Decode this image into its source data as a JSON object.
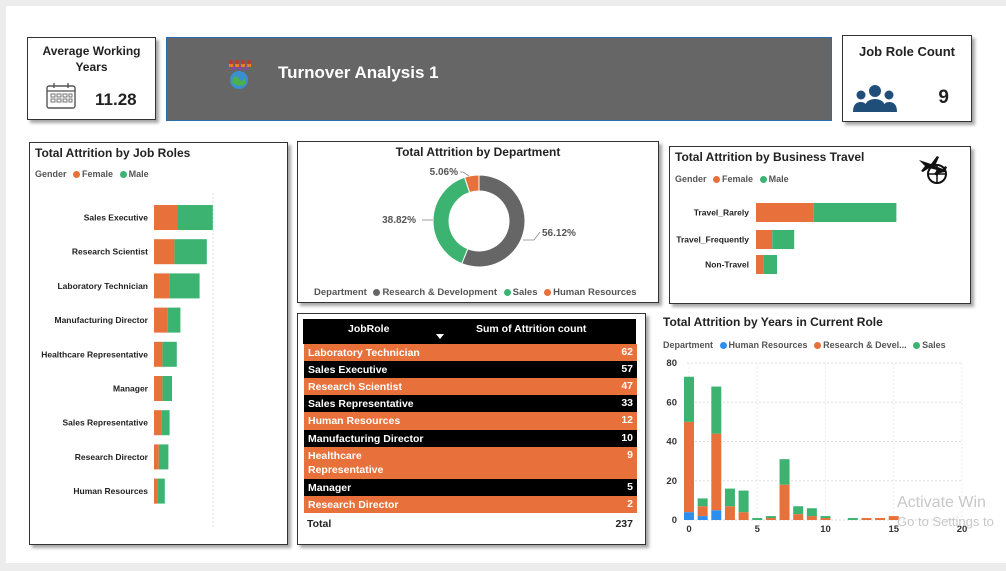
{
  "kpi_avg": {
    "label_line1": "Average Working",
    "label_line2": "Years",
    "value": "11.28",
    "icon": "calendar-icon"
  },
  "header": {
    "title": "Turnover Analysis 1",
    "icon": "people-globe-icon",
    "bg": "#666666"
  },
  "kpi_role": {
    "label": "Job Role Count",
    "value": "9",
    "icon": "group-icon",
    "icon_color": "#1f4e79"
  },
  "colors": {
    "female": "#e8703a",
    "male": "#3cb371",
    "rd": "#666666",
    "sales": "#3cb371",
    "hr": "#e8703a",
    "hr_blue": "#2c8ff0",
    "table_orange": "#e8703a",
    "table_black": "#000000"
  },
  "job_roles_chart": {
    "title": "Total Attrition by Job Roles",
    "legend_title": "Gender",
    "legend": [
      "Female",
      "Male"
    ]
  },
  "department_chart": {
    "title": "Total Attrition by Department",
    "legend_title": "Department",
    "legend": [
      "Research & Development",
      "Sales",
      "Human Resources"
    ],
    "labels": [
      "5.06%",
      "38.82%",
      "56.12%"
    ]
  },
  "travel_chart": {
    "title": "Total Attrition by Business Travel",
    "legend_title": "Gender",
    "legend": [
      "Female",
      "Male"
    ],
    "icon": "airplane-globe-icon"
  },
  "years_chart": {
    "title": "Total Attrition by Years in Current Role",
    "legend_title": "Department",
    "legend": [
      "Human Resources",
      "Research & Devel...",
      "Sales"
    ]
  },
  "table": {
    "col1": "JobRole",
    "col2": "Sum of Attrition count",
    "rows": [
      {
        "role": "Laboratory Technician",
        "count": "62"
      },
      {
        "role": "Sales Executive",
        "count": "57"
      },
      {
        "role": "Research Scientist",
        "count": "47"
      },
      {
        "role": "Sales Representative",
        "count": "33"
      },
      {
        "role": "Human Resources",
        "count": "12"
      },
      {
        "role": "Manufacturing Director",
        "count": "10"
      },
      {
        "role": "Healthcare Representative",
        "count": "9"
      },
      {
        "role": "Manager",
        "count": "5"
      },
      {
        "role": "Research Director",
        "count": "2"
      }
    ],
    "total_label": "Total",
    "total_value": "237"
  },
  "watermark": {
    "line1": "Activate Win",
    "line2": "Go to Settings to"
  },
  "chart_data": [
    {
      "type": "bar",
      "orientation": "horizontal",
      "stacked": true,
      "title": "Total Attrition by Job Roles",
      "categories": [
        "Sales Executive",
        "Research Scientist",
        "Laboratory Technician",
        "Manufacturing Director",
        "Healthcare Representative",
        "Manager",
        "Sales Representative",
        "Research Director",
        "Human Resources"
      ],
      "series": [
        {
          "name": "Female",
          "values": [
            20,
            17,
            13,
            11,
            7,
            7,
            6,
            4,
            3
          ]
        },
        {
          "name": "Male",
          "values": [
            29,
            27,
            25,
            11,
            12,
            8,
            7,
            8,
            6
          ]
        }
      ]
    },
    {
      "type": "pie",
      "donut": true,
      "title": "Total Attrition by Department",
      "categories": [
        "Research & Development",
        "Sales",
        "Human Resources"
      ],
      "values": [
        56.12,
        38.82,
        5.06
      ]
    },
    {
      "type": "bar",
      "orientation": "horizontal",
      "stacked": true,
      "title": "Total Attrition by Business Travel",
      "categories": [
        "Travel_Rarely",
        "Travel_Frequently",
        "Non-Travel"
      ],
      "series": [
        {
          "name": "Female",
          "values": [
            60,
            17,
            8
          ]
        },
        {
          "name": "Male",
          "values": [
            87,
            23,
            14
          ]
        }
      ]
    },
    {
      "type": "bar",
      "stacked": true,
      "title": "Total Attrition by Years in Current Role",
      "x": [
        0,
        1,
        2,
        3,
        4,
        5,
        6,
        7,
        8,
        9,
        10,
        11,
        12,
        13,
        14,
        15
      ],
      "series": [
        {
          "name": "Human Resources",
          "values": [
            4,
            2,
            5,
            0,
            0,
            0,
            0,
            0,
            0,
            0,
            0,
            0,
            0,
            0,
            0,
            0
          ]
        },
        {
          "name": "Research & Devel...",
          "values": [
            46,
            5,
            39,
            7,
            4,
            0,
            1,
            18,
            3,
            2,
            1,
            0,
            0,
            1,
            1,
            2
          ]
        },
        {
          "name": "Sales",
          "values": [
            23,
            4,
            24,
            9,
            11,
            1,
            1,
            13,
            4,
            4,
            1,
            0,
            1,
            0,
            0,
            0
          ]
        }
      ],
      "ylim": [
        0,
        80
      ],
      "yticks": [
        0,
        20,
        40,
        60,
        80
      ],
      "xticks": [
        0,
        5,
        10,
        15,
        20
      ],
      "grid": true
    }
  ]
}
